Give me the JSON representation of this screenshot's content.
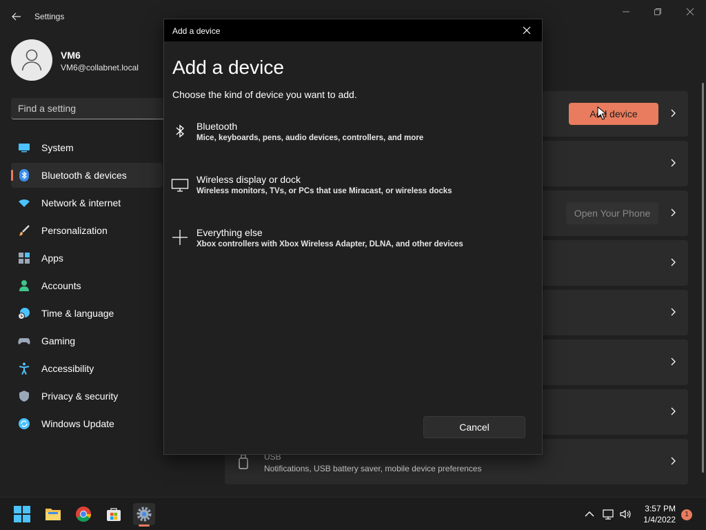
{
  "window": {
    "title": "Settings"
  },
  "user": {
    "name": "VM6",
    "email": "VM6@collabnet.local"
  },
  "search": {
    "placeholder": "Find a setting"
  },
  "sidebar": {
    "items": [
      {
        "label": "System",
        "icon": "system-icon",
        "color": "#4cc2ff"
      },
      {
        "label": "Bluetooth & devices",
        "icon": "bluetooth-icon",
        "color": "#3b8eea",
        "active": true
      },
      {
        "label": "Network & internet",
        "icon": "wifi-icon",
        "color": "#4cc2ff"
      },
      {
        "label": "Personalization",
        "icon": "brush-icon",
        "color": "#f2a85c"
      },
      {
        "label": "Apps",
        "icon": "apps-icon",
        "color": "#9aa7b8"
      },
      {
        "label": "Accounts",
        "icon": "accounts-icon",
        "color": "#3fc68b"
      },
      {
        "label": "Time & language",
        "icon": "clock-globe-icon",
        "color": "#4cc2ff"
      },
      {
        "label": "Gaming",
        "icon": "gamepad-icon",
        "color": "#9aa7b8"
      },
      {
        "label": "Accessibility",
        "icon": "accessibility-icon",
        "color": "#4cc2ff"
      },
      {
        "label": "Privacy & security",
        "icon": "shield-icon",
        "color": "#9aa7b8"
      },
      {
        "label": "Windows Update",
        "icon": "update-icon",
        "color": "#4cc2ff"
      }
    ]
  },
  "main": {
    "add_device_label": "Add device",
    "open_phone_label": "Open Your Phone",
    "usb_title": "USB",
    "usb_desc": "Notifications, USB battery saver, mobile device preferences"
  },
  "dialog": {
    "title": "Add a device",
    "heading": "Add a device",
    "subtitle": "Choose the kind of device you want to add.",
    "options": [
      {
        "title": "Bluetooth",
        "desc": "Mice, keyboards, pens, audio devices, controllers, and more",
        "icon": "bluetooth-icon"
      },
      {
        "title": "Wireless display or dock",
        "desc": "Wireless monitors, TVs, or PCs that use Miracast, or wireless docks",
        "icon": "monitor-icon"
      },
      {
        "title": "Everything else",
        "desc": "Xbox controllers with Xbox Wireless Adapter, DLNA, and other devices",
        "icon": "plus-icon"
      }
    ],
    "cancel_label": "Cancel"
  },
  "taskbar": {
    "time": "3:57 PM",
    "date": "1/4/2022",
    "notification_count": "1"
  },
  "colors": {
    "accent": "#e97c5e",
    "background": "#202020",
    "card": "#2b2b2b"
  }
}
